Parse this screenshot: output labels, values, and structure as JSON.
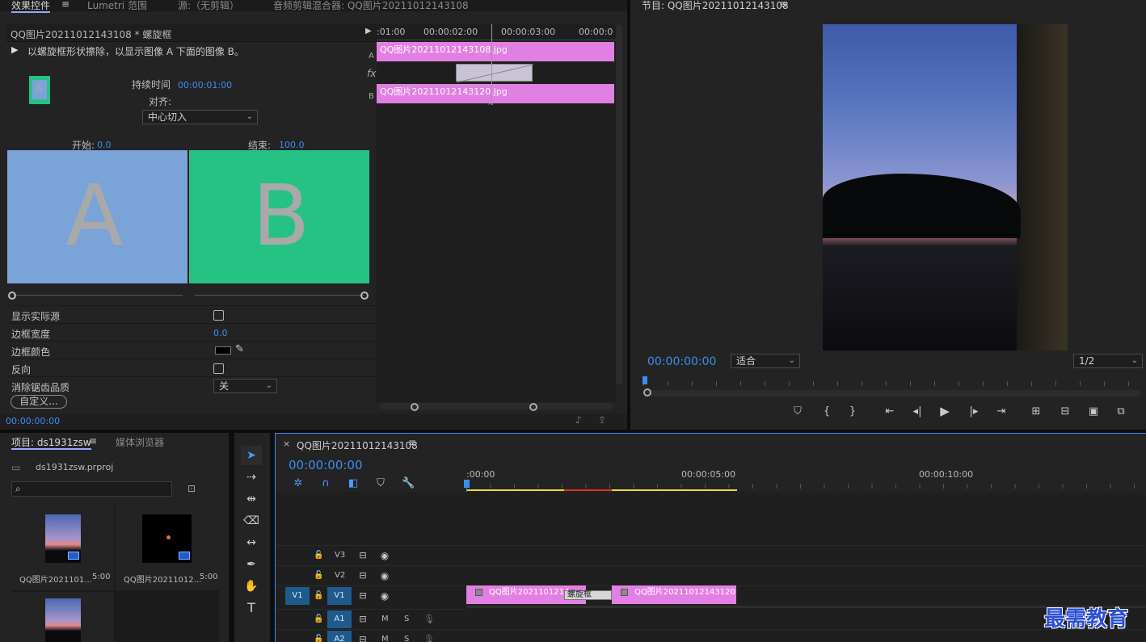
{
  "effect_controls": {
    "tabs": [
      "效果控件",
      "Lumetri 范围",
      "源:（无剪辑）",
      "音频剪辑混合器: QQ图片20211012143108"
    ],
    "header": "QQ图片20211012143108 * 螺旋框",
    "description": "以螺旋框形状擦除，以显示图像 A 下面的图像 B。",
    "duration_label": "持续时间",
    "duration_value": "00:00:01:00",
    "align_label": "对齐:",
    "align_value": "中心切入",
    "start_label": "开始:",
    "start_value": "0.0",
    "end_label": "结束:",
    "end_value": "100.0",
    "preview_a": "A",
    "preview_b": "B",
    "thumb_letter": "A",
    "properties": {
      "show_actual": "显示实际源",
      "border_width": "边框宽度",
      "border_width_value": "0.0",
      "border_color": "边框颜色",
      "reverse": "反向",
      "antialias": "消除锯齿品质",
      "antialias_value": "关",
      "custom_button": "自定义..."
    },
    "footer_time": "00:00:00:00",
    "mini_timeline": {
      "ruler": [
        ":01:00",
        "00:00:02:00",
        "00:00:03:00",
        "00:00:0"
      ],
      "track_a": "A",
      "track_b": "B",
      "fx": "fx",
      "clip_a": "QQ图片20211012143108.jpg",
      "clip_b": "QQ图片20211012143120.jpg"
    }
  },
  "program_monitor": {
    "title": "节目: QQ图片20211012143108",
    "timecode": "00:00:00:00",
    "fit": "适合",
    "resolution": "1/2"
  },
  "project": {
    "tabs": [
      "项目: ds1931zsw",
      "媒体浏览器"
    ],
    "file": "ds1931zsw.prproj",
    "items": [
      {
        "name": "QQ图片2021101...",
        "duration": "5:00"
      },
      {
        "name": "QQ图片20211012...",
        "duration": "5:00"
      }
    ]
  },
  "timeline": {
    "title": "QQ图片20211012143108",
    "close": "×",
    "timecode": "00:00:00:00",
    "ruler": [
      ":00:00",
      "00:00:05:00",
      "00:00:10:00"
    ],
    "tracks": [
      {
        "name": "V3"
      },
      {
        "name": "V2"
      },
      {
        "name": "V1",
        "source": "V1"
      },
      {
        "name": "A1",
        "m": "M",
        "s": "S"
      },
      {
        "name": "A2",
        "m": "M",
        "s": "S"
      }
    ],
    "clip1": "QQ图片2021101214",
    "transition": "螺旋框",
    "clip2": "QQ图片20211012143120.jpg"
  },
  "watermark": "最需教育",
  "colors": {
    "clip": "#e27fe2",
    "accent": "#3b8ef0",
    "preview_a": "#7aa3d8",
    "preview_b": "#26c285"
  }
}
